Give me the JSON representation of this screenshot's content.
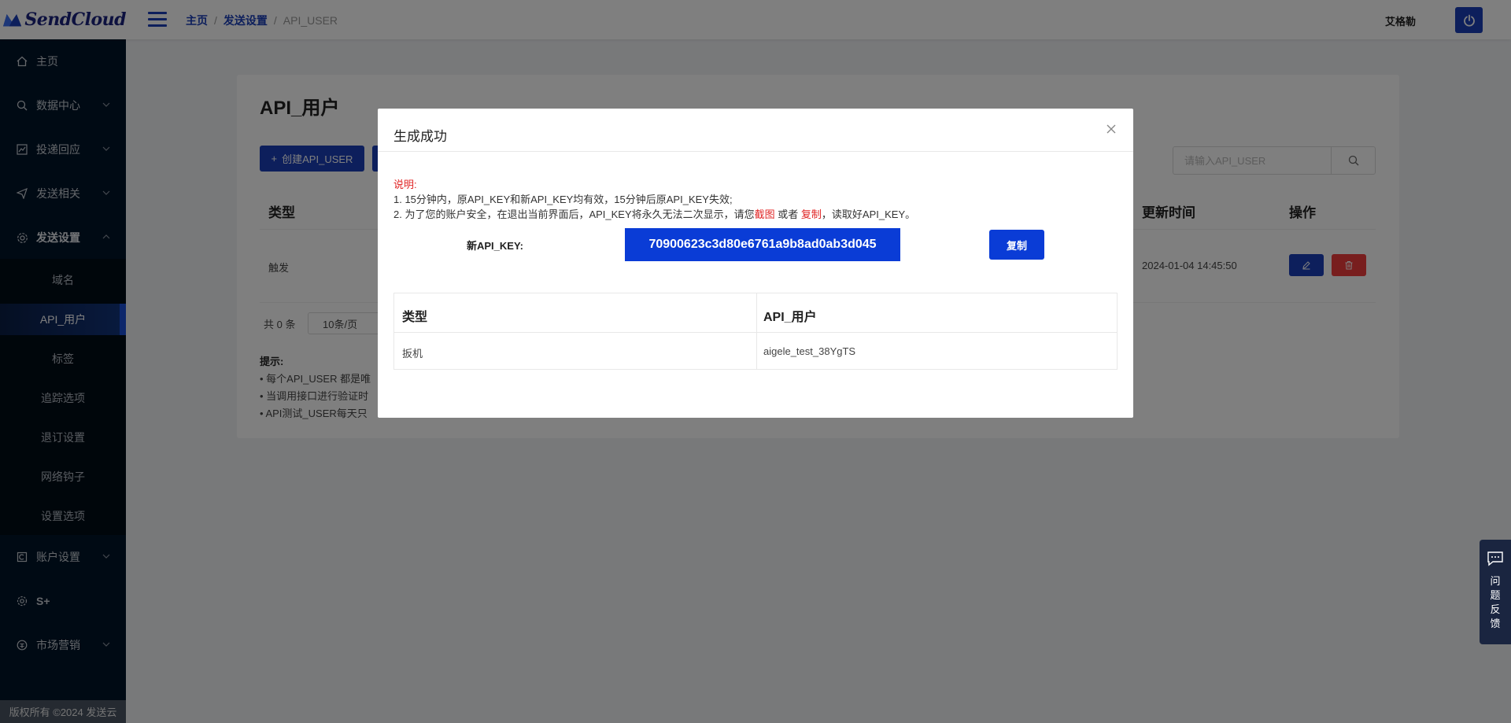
{
  "header": {
    "logo_text": "SendCloud",
    "breadcrumb": [
      "主页",
      "发送设置",
      "API_USER"
    ],
    "username": "艾格勒"
  },
  "sidebar": {
    "items": [
      {
        "label": "主页",
        "icon": "home-icon"
      },
      {
        "label": "数据中心",
        "icon": "data-icon"
      },
      {
        "label": "投递回应",
        "icon": "chart-icon"
      },
      {
        "label": "发送相关",
        "icon": "send-icon"
      },
      {
        "label": "发送设置",
        "icon": "gear-icon"
      },
      {
        "label": "账户设置",
        "icon": "account-icon"
      },
      {
        "label": "S+",
        "icon": "splus-icon"
      },
      {
        "label": "市场营销",
        "icon": "market-icon"
      }
    ],
    "submenu": [
      "域名",
      "API_用户",
      "标签",
      "追踪选项",
      "退订设置",
      "网络钩子",
      "设置选项"
    ],
    "active_submenu": "API_用户",
    "footer": "版权所有 ©2024 发送云"
  },
  "main": {
    "title": "API_用户",
    "create_button": "创建API_USER",
    "search_placeholder": "请输入API_USER",
    "columns": {
      "type": "类型",
      "updated": "更新时间",
      "actions": "操作"
    },
    "row": {
      "type": "触发",
      "updated": "2024-01-04 14:45:50"
    },
    "pager": {
      "total": "共 0 条",
      "page_size": "10条/页"
    },
    "tips": {
      "title": "提示:",
      "lines": [
        "• 每个API_USER 都是唯",
        "• 当调用接口进行验证时",
        "• API测试_USER每天只"
      ]
    }
  },
  "modal": {
    "title": "生成成功",
    "note_label": "说明:",
    "note1": "1. 15分钟内，原API_KEY和新API_KEY均有效，15分钟后原API_KEY失效;",
    "note2_pre": "2. 为了您的账户安全，在退出当前界面后，API_KEY将永久无法二次显示，请您",
    "note2_link1": "截图",
    "note2_mid": " 或者 ",
    "note2_link2": "复制",
    "note2_post": "，读取好API_KEY。",
    "key_label": "新API_KEY:",
    "key_value": "70900623c3d80e6761a9b8ad0ab3d045",
    "copy_button": "复制",
    "table": {
      "headers": [
        "类型",
        "API_用户"
      ],
      "row": [
        "扳机",
        "aigele_test_38YgTS"
      ]
    }
  },
  "feedback": {
    "label": "问题反馈"
  },
  "colors": {
    "brand": "#1a3fb8",
    "sidebar": "#001529",
    "key_bg": "#0a3cd6",
    "danger": "#e02424"
  }
}
